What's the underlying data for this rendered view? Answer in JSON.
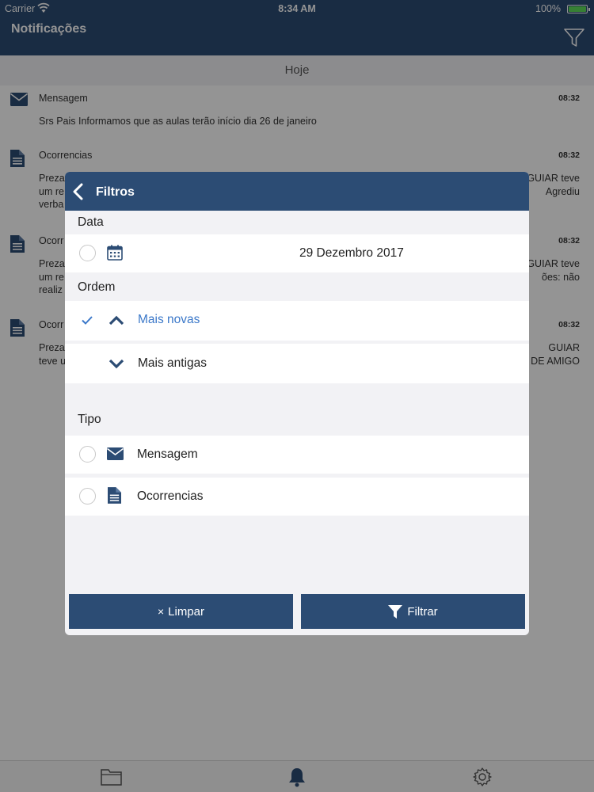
{
  "status_bar": {
    "carrier": "Carrier",
    "time": "8:34 AM",
    "battery": "100%"
  },
  "app_bar": {
    "title": "Notificações",
    "filter_icon": "funnel-icon"
  },
  "list": {
    "day_header": "Hoje",
    "items": [
      {
        "type": "Mensagem",
        "time": "08:32",
        "icon": "envelope-icon",
        "body": "Srs Pais Informamos que as aulas terão início dia 26 de janeiro"
      },
      {
        "type": "Ocorrencias",
        "time": "08:32",
        "icon": "document-icon",
        "body_line1_start": "Preza",
        "body_line1_end": "GUIAR teve",
        "body_line2_start": "um re",
        "body_line2_end": "Agrediu",
        "body_line3_start": "verba"
      },
      {
        "type": "Ocorr",
        "time": "08:32",
        "icon": "document-icon",
        "body_line1_start": "Preza",
        "body_line1_end": "GUIAR teve",
        "body_line2_start": "um re",
        "body_line2_end": "ões: não",
        "body_line3_start": "realiz"
      },
      {
        "type": "Ocorr",
        "time": "08:32",
        "icon": "document-icon",
        "body_line1_start": "Preza",
        "body_line1_end": "GUIAR",
        "body_line2_start": "teve u",
        "body_line2_end": "DE AMIGO"
      }
    ]
  },
  "tab_bar": {
    "tabs": [
      "folder-icon",
      "bell-icon",
      "gear-icon"
    ]
  },
  "modal": {
    "title": "Filtros",
    "data_section": {
      "label": "Data",
      "date": "29 Dezembro 2017"
    },
    "ordem_section": {
      "label": "Ordem",
      "options": [
        {
          "label": "Mais novas",
          "selected": true
        },
        {
          "label": "Mais antigas",
          "selected": false
        }
      ]
    },
    "tipo_section": {
      "label": "Tipo",
      "options": [
        {
          "label": "Mensagem",
          "icon": "envelope-icon"
        },
        {
          "label": "Ocorrencias",
          "icon": "document-icon"
        }
      ]
    },
    "buttons": {
      "clear": "Limpar",
      "clear_symbol": "×",
      "filter": "Filtrar"
    }
  },
  "colors": {
    "primary": "#2c4c74",
    "accent": "#3b78c9",
    "background": "#f2f2f5"
  }
}
